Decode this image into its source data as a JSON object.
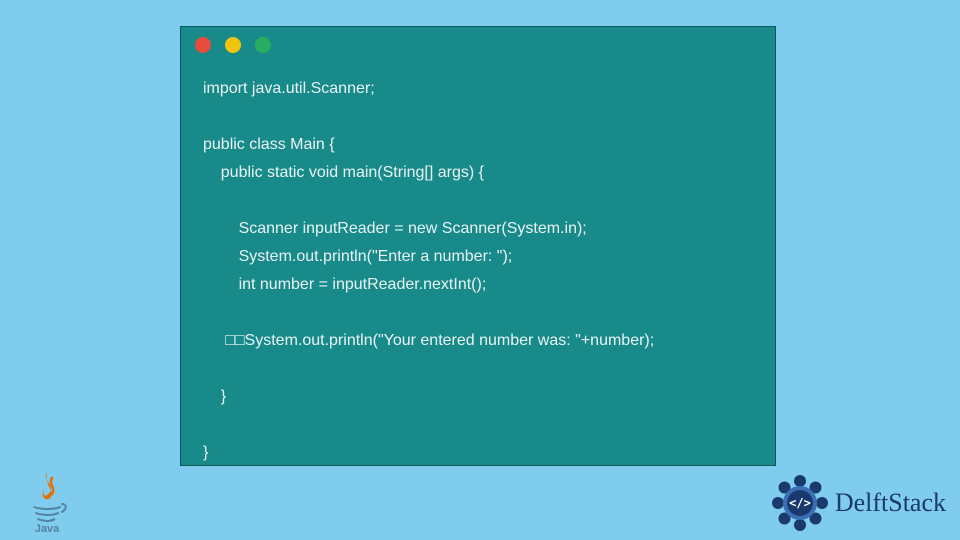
{
  "code": {
    "lines": [
      "import java.util.Scanner;",
      "",
      "public class Main {",
      "    public static void main(String[] args) {",
      "",
      "        Scanner inputReader = new Scanner(System.in);",
      "        System.out.println(\"Enter a number: \");",
      "        int number = inputReader.nextInt();",
      "",
      "     □□System.out.println(\"Your entered number was: \"+number);",
      "",
      "    }",
      "",
      "}"
    ]
  },
  "branding": {
    "java_label": "Java",
    "delft_label": "DelftStack"
  },
  "colors": {
    "page_bg": "#7fccef",
    "window_bg": "#198a8a",
    "code_text": "#e8f4f4",
    "dot_red": "#e74c3c",
    "dot_yellow": "#f1c40f",
    "dot_green": "#27ae60",
    "delft_blue": "#1a3a6e",
    "java_red": "#e76f00",
    "java_blue": "#5382a1"
  }
}
